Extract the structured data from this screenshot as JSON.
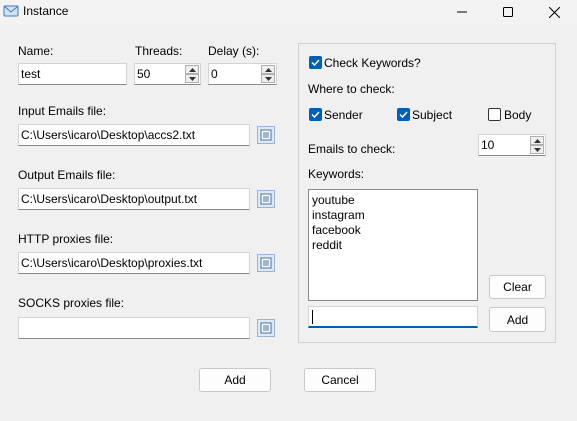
{
  "window": {
    "title": "Instance",
    "minimize": "minimize",
    "maximize": "maximize",
    "close": "close"
  },
  "form": {
    "name_label": "Name:",
    "name_value": "test",
    "threads_label": "Threads:",
    "threads_value": "50",
    "delay_label": "Delay (s):",
    "delay_value": "0",
    "input_label": "Input Emails file:",
    "input_value": "C:\\Users\\icaro\\Desktop\\accs2.txt",
    "output_label": "Output Emails file:",
    "output_value": "C:\\Users\\icaro\\Desktop\\output.txt",
    "http_label": "HTTP proxies file:",
    "http_value": "C:\\Users\\icaro\\Desktop\\proxies.txt",
    "socks_label": "SOCKS proxies file:",
    "socks_value": ""
  },
  "keywords_panel": {
    "check_label": "Check Keywords?",
    "check_checked": true,
    "where_label": "Where to check:",
    "sender_label": "Sender",
    "sender_checked": true,
    "subject_label": "Subject",
    "subject_checked": true,
    "body_label": "Body",
    "body_checked": false,
    "emails_label": "Emails to check:",
    "emails_value": "10",
    "keywords_label": "Keywords:",
    "keywords": [
      "youtube",
      "instagram",
      "facebook",
      "reddit"
    ],
    "keyword_input_value": "",
    "clear_label": "Clear",
    "add_keyword_label": "Add"
  },
  "footer": {
    "add_label": "Add",
    "cancel_label": "Cancel"
  },
  "colors": {
    "accent": "#005fb8",
    "window_bg": "#f0f0f0"
  }
}
